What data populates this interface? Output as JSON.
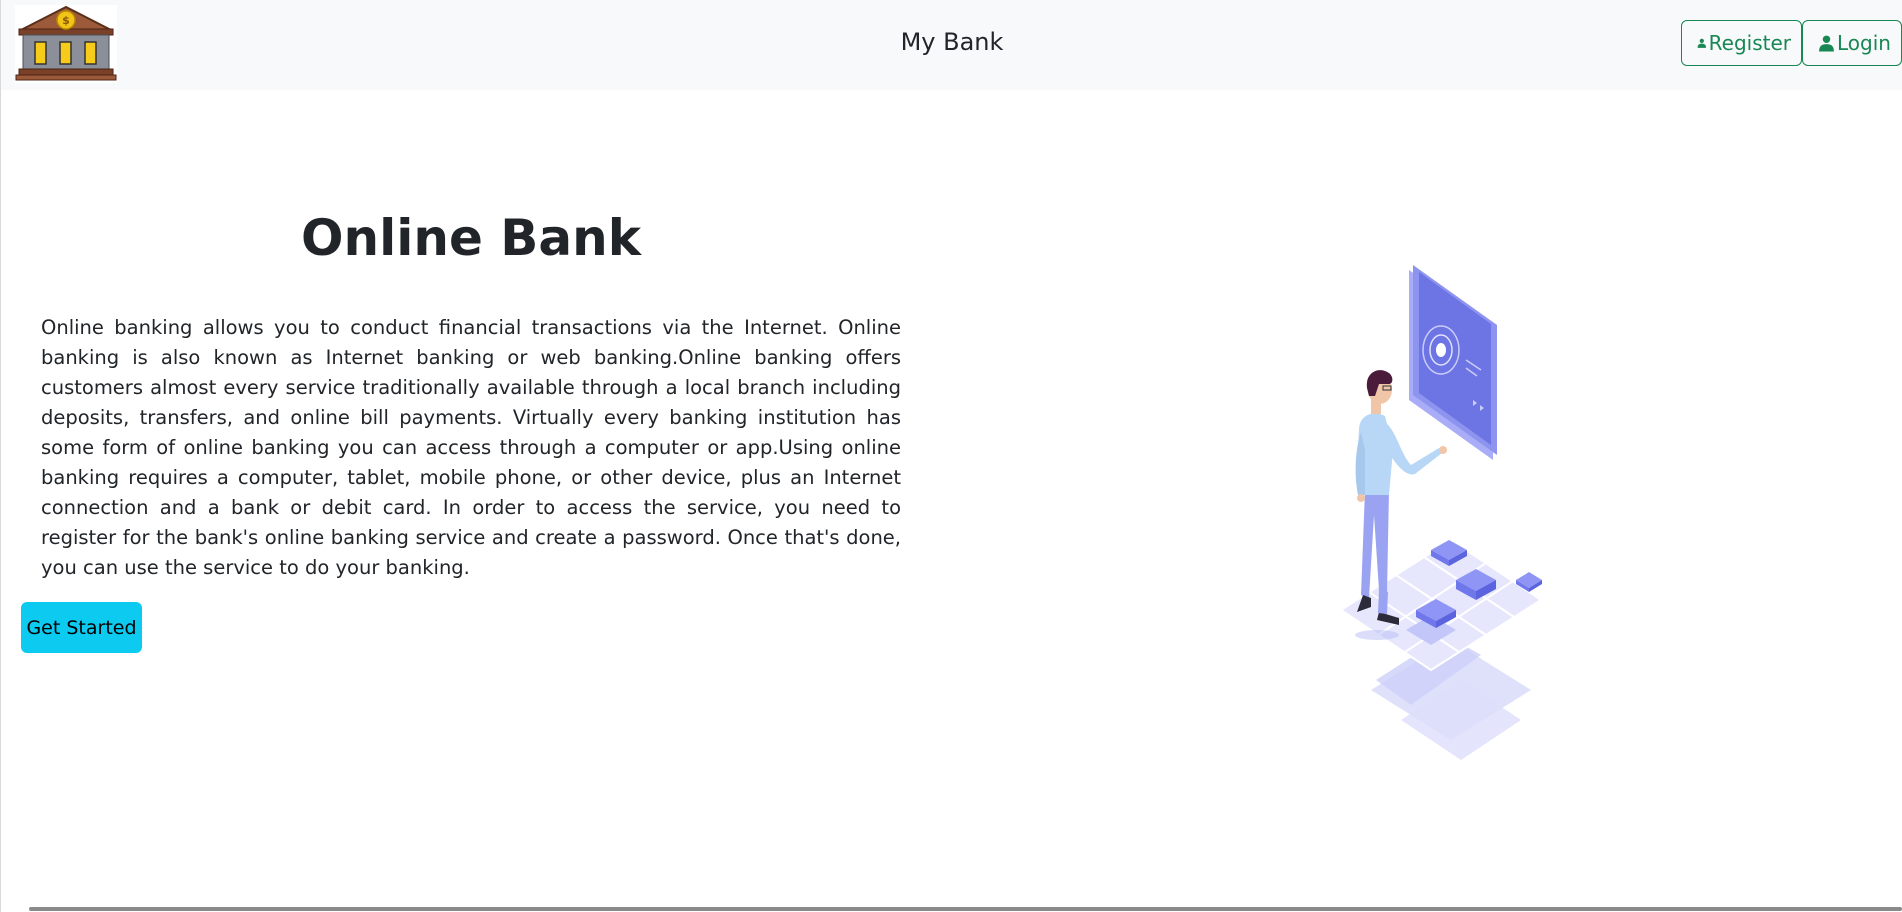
{
  "navbar": {
    "brand": "My Bank",
    "register_label": "Register",
    "login_label": "Login"
  },
  "hero": {
    "title": "Online Bank",
    "description": "Online banking allows you to conduct financial transactions via the Internet. Online banking is also known as Internet banking or web banking.Online banking offers customers almost every service traditionally available through a local branch including deposits, transfers, and online bill payments. Virtually every banking institution has some form of online banking you can access through a computer or app.Using online banking requires a computer, tablet, mobile phone, or other device, plus an Internet connection and a bank or debit card. In order to access the service, you need to register for the bank's online banking service and create a password. Once that's done, you can use the service to do your banking.",
    "cta_label": "Get Started"
  },
  "icons": {
    "logo": "bank-building-icon",
    "register": "user-icon",
    "login": "user-icon"
  },
  "colors": {
    "navbar_bg": "#f8f9fa",
    "outline_success": "#198754",
    "cta_bg": "#0dcaf0",
    "illustration_accent": "#7b83f0"
  }
}
